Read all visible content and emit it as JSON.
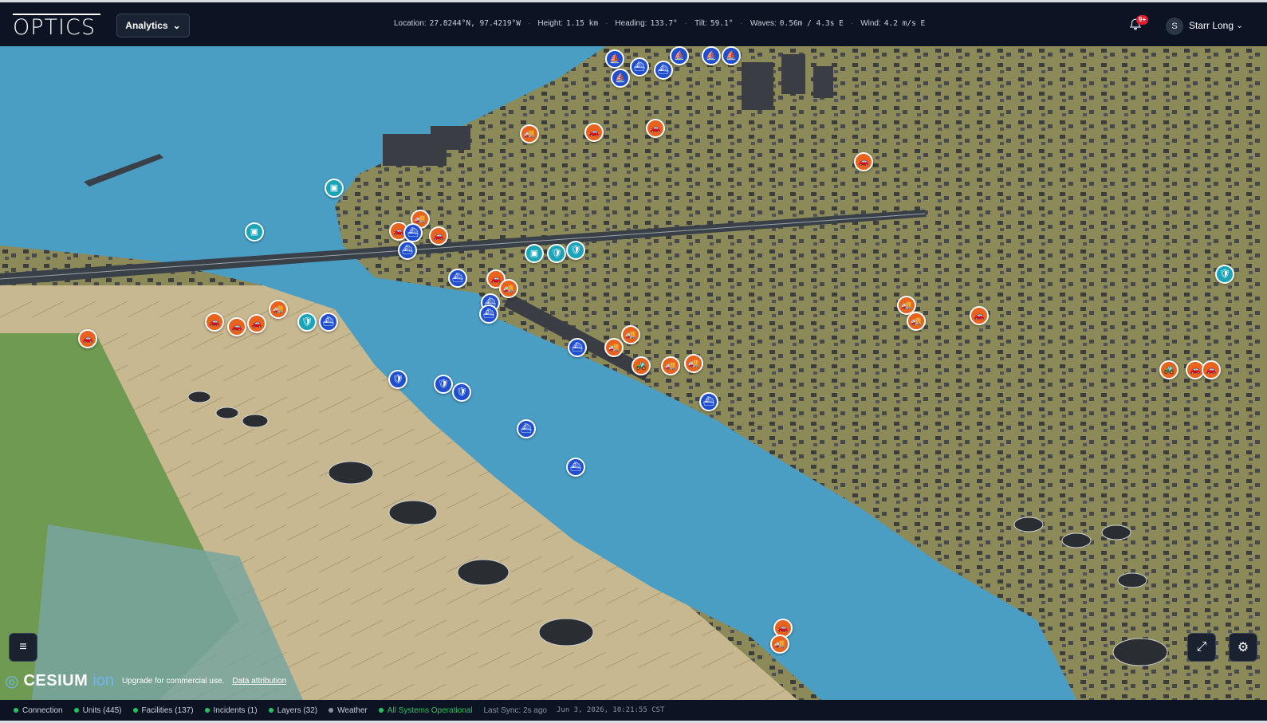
{
  "app": {
    "logo_text": "OPTICS"
  },
  "header": {
    "view_selector": "Analytics",
    "telemetry": [
      {
        "label": "Location:",
        "value": "27.8244°N, 97.4219°W"
      },
      {
        "label": "Height:",
        "value": "1.15 km"
      },
      {
        "label": "Heading:",
        "value": "133.7°"
      },
      {
        "label": "Tilt:",
        "value": "59.1°"
      },
      {
        "label": "Waves:",
        "value": "0.56m / 4.3s E"
      },
      {
        "label": "Wind:",
        "value": "4.2 m/s E"
      }
    ],
    "notifications_badge": "9+",
    "user": {
      "initial": "S",
      "name": "Starr Long"
    }
  },
  "map": {
    "attribution": {
      "brand": "CESIUM",
      "brand_suffix": "ion",
      "upgrade_text": "Upgrade for commercial use.",
      "attribution_link": "Data attribution"
    },
    "marker_types": {
      "orange": "incident/vehicle",
      "blue": "vessel/unit",
      "teal": "camera/security"
    },
    "colors": {
      "orange": "#e8641e",
      "blue": "#1f4fcf",
      "teal": "#1aa4b8",
      "water": "#4a9ec4"
    }
  },
  "statusbar": {
    "items": [
      {
        "label": "Connection",
        "state": "green"
      },
      {
        "label": "Units (445)",
        "state": "green"
      },
      {
        "label": "Facilities (137)",
        "state": "green"
      },
      {
        "label": "Incidents (1)",
        "state": "green"
      },
      {
        "label": "Layers (32)",
        "state": "green"
      },
      {
        "label": "Weather",
        "state": "gray"
      }
    ],
    "system_status": "All Systems Operational",
    "last_sync": "Last Sync: 2s ago",
    "timestamp": "Jun 3, 2026, 10:21:55 CST"
  }
}
